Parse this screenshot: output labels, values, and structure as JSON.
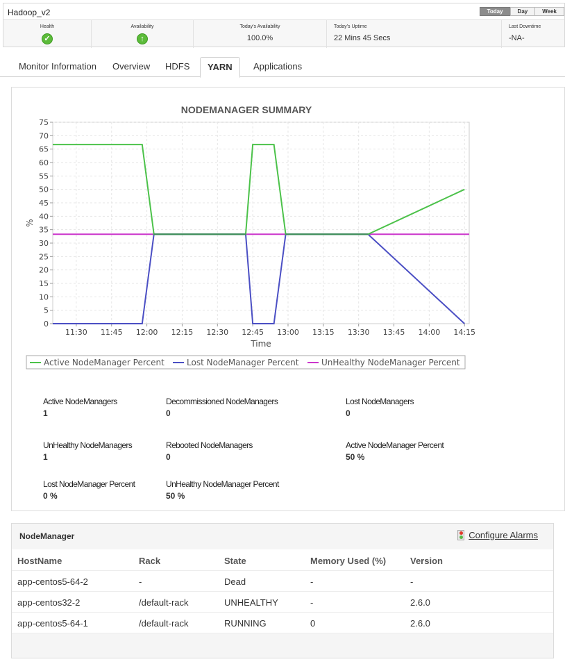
{
  "header": {
    "title": "Hadoop_v2",
    "periods": [
      "Today",
      "Day",
      "Week"
    ],
    "stats": {
      "health_label": "Health",
      "availability_label": "Availability",
      "todays_availability_label": "Today's Availability",
      "todays_availability_value": "100.0%",
      "todays_uptime_label": "Today's Uptime",
      "todays_uptime_value": "22 Mins 45 Secs",
      "last_downtime_label": "Last Downtime",
      "last_downtime_value": "-NA-"
    }
  },
  "icons": {
    "health": "check-circle-icon",
    "availability": "up-arrow-icon",
    "alarms": "traffic-light-icon"
  },
  "colors": {
    "active": "#4cc24a",
    "lost": "#4b4fc4",
    "unhealthy": "#cc36cc",
    "combined": "#3f8f5a"
  },
  "tabs": [
    "Monitor Information",
    "Overview",
    "HDFS",
    "YARN",
    "Applications"
  ],
  "active_tab": "YARN",
  "chart_data": {
    "type": "line",
    "title": "NODEMANAGER SUMMARY",
    "xlabel": "Time",
    "ylabel": "%",
    "ylim": [
      0,
      75
    ],
    "yticks": [
      0,
      5,
      10,
      15,
      20,
      25,
      30,
      35,
      40,
      45,
      50,
      55,
      60,
      65,
      70,
      75
    ],
    "xlim": [
      "11:20",
      "14:17"
    ],
    "xticks": [
      "11:30",
      "11:45",
      "12:00",
      "12:15",
      "12:30",
      "12:45",
      "13:00",
      "13:15",
      "13:30",
      "13:45",
      "14:00",
      "14:15"
    ],
    "grid": true,
    "legend_position": "bottom",
    "series": [
      {
        "name": "Active NodeManager Percent",
        "x": [
          "11:20",
          "11:58",
          "12:03",
          "12:42",
          "12:45",
          "12:54",
          "12:59",
          "13:34",
          "14:15"
        ],
        "values": [
          66.7,
          66.7,
          33.3,
          33.3,
          66.7,
          66.7,
          33.3,
          33.3,
          50
        ]
      },
      {
        "name": "Lost NodeManager Percent",
        "x": [
          "11:20",
          "11:58",
          "12:03",
          "12:42",
          "12:45",
          "12:54",
          "12:59",
          "13:34",
          "14:15"
        ],
        "values": [
          0,
          0,
          33.3,
          33.3,
          0,
          0,
          33.3,
          33.3,
          0
        ]
      },
      {
        "name": "UnHealthy NodeManager Percent",
        "x": [
          "11:20",
          "14:17"
        ],
        "values": [
          33.3,
          33.3
        ]
      }
    ]
  },
  "metrics": [
    {
      "label": "Active NodeManagers",
      "value": "1"
    },
    {
      "label": "Decommissioned NodeManagers",
      "value": "0"
    },
    {
      "label": "Lost NodeManagers",
      "value": "0"
    },
    {
      "label": "UnHealthy NodeManagers",
      "value": "1"
    },
    {
      "label": "Rebooted NodeManagers",
      "value": "0"
    },
    {
      "label": "Active NodeManager Percent",
      "value": "50 %"
    },
    {
      "label": "Lost NodeManager Percent",
      "value": "0 %"
    },
    {
      "label": "UnHealthy NodeManager Percent",
      "value": "50 %"
    }
  ],
  "nodemanager": {
    "title": "NodeManager",
    "configure_alarms": "Configure Alarms",
    "columns": [
      "HostName",
      "Rack",
      "State",
      "Memory Used  (%)",
      "Version"
    ],
    "rows": [
      [
        "app-centos5-64-2",
        "-",
        "Dead",
        "-",
        "-"
      ],
      [
        "app-centos32-2",
        "/default-rack",
        "UNHEALTHY",
        "-",
        "2.6.0"
      ],
      [
        "app-centos5-64-1",
        "/default-rack",
        "RUNNING",
        "0",
        "2.6.0"
      ]
    ]
  }
}
